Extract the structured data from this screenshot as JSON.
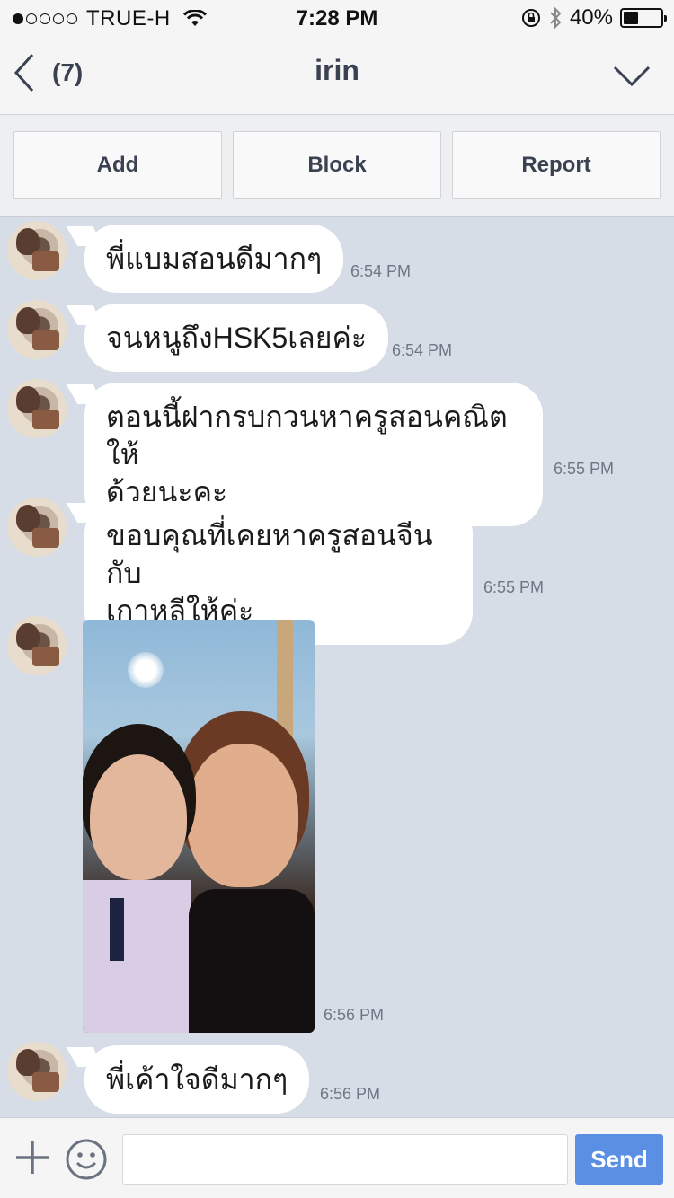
{
  "status_bar": {
    "carrier": "TRUE-H",
    "signal_bars_filled": 1,
    "signal_bars_total": 5,
    "time": "7:28 PM",
    "battery_percent": "40%",
    "battery_level": 0.4
  },
  "header": {
    "back_count": "(7)",
    "title": "irin",
    "icons": {
      "back": "chevron-left-icon",
      "menu": "chevron-down-icon"
    }
  },
  "actions": {
    "add_label": "Add",
    "block_label": "Block",
    "report_label": "Report"
  },
  "messages": [
    {
      "text": "พี่แบมสอนดีมากๆ",
      "time": "6:54 PM"
    },
    {
      "text": "จนหนูถึงHSK5เลยค่ะ",
      "time": "6:54 PM"
    },
    {
      "text": "ตอนนี้ฝากรบกวนหาครูสอนคณิตให้\nด้วยนะคะ",
      "time": "6:55 PM"
    },
    {
      "text": "ขอบคุณที่เคยหาครูสอนจีนกับ\nเกาหลีให้ค่ะ",
      "time": "6:55 PM"
    },
    {
      "type": "image",
      "time": "6:56 PM"
    },
    {
      "text": "พี่เค้าใจดีมากๆ",
      "time": "6:56 PM"
    }
  ],
  "input_bar": {
    "send_label": "Send",
    "text_value": "",
    "icons": {
      "attach": "plus-icon",
      "sticker": "smiley-icon"
    }
  },
  "colors": {
    "chat_background": "#d7dde6",
    "send_button": "#5b8fe3",
    "bubble": "#ffffff"
  }
}
